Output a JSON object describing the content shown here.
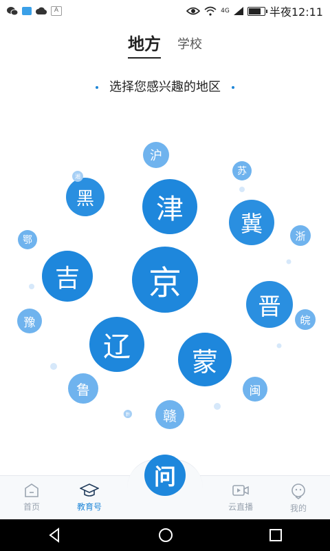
{
  "status_bar": {
    "time": "半夜12:11",
    "network": "4G",
    "battery_level": 0.8,
    "notification_icons": [
      "wechat-icon",
      "gallery-icon",
      "cloud-icon",
      "a-icon"
    ]
  },
  "top_tabs": [
    {
      "label": "地方",
      "active": true
    },
    {
      "label": "学校",
      "active": false
    }
  ],
  "subtitle": "选择您感兴趣的地区",
  "bubbles": [
    {
      "label": "京",
      "size": "big"
    },
    {
      "label": "津",
      "size": "big"
    },
    {
      "label": "吉",
      "size": "big"
    },
    {
      "label": "辽",
      "size": "big"
    },
    {
      "label": "蒙",
      "size": "big"
    },
    {
      "label": "晋",
      "size": "mid"
    },
    {
      "label": "冀",
      "size": "mid"
    },
    {
      "label": "黑",
      "size": "mid"
    },
    {
      "label": "沪",
      "size": "small"
    },
    {
      "label": "苏",
      "size": "small"
    },
    {
      "label": "浙",
      "size": "small"
    },
    {
      "label": "皖",
      "size": "small"
    },
    {
      "label": "鄂",
      "size": "small"
    },
    {
      "label": "豫",
      "size": "small"
    },
    {
      "label": "鲁",
      "size": "small"
    },
    {
      "label": "赣",
      "size": "small"
    },
    {
      "label": "闽",
      "size": "small"
    },
    {
      "label": "湘",
      "size": "tiny"
    },
    {
      "label": "黔",
      "size": "tiny"
    }
  ],
  "bottom_nav": [
    {
      "label": "首页",
      "icon": "home-icon",
      "active": false
    },
    {
      "label": "教育号",
      "icon": "graduation-cap-icon",
      "active": true
    },
    {
      "label": "云直播",
      "icon": "video-icon",
      "active": false
    },
    {
      "label": "我的",
      "icon": "profile-icon",
      "active": false
    }
  ],
  "ask_button": {
    "label": "问"
  },
  "colors": {
    "accent": "#1e87dc",
    "light_bubble": "#6fb3ee"
  }
}
